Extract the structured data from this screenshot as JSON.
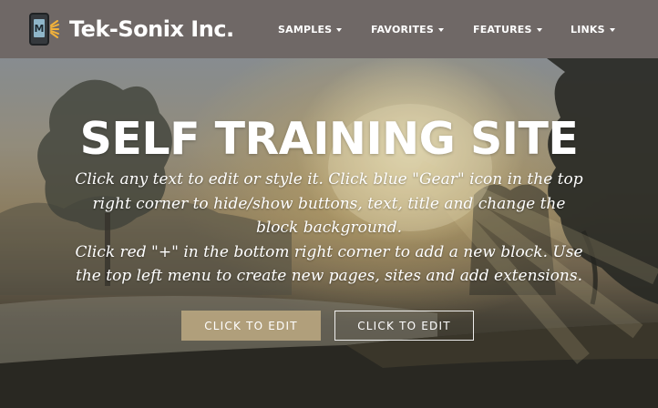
{
  "brand": {
    "logo_letter": "M",
    "name": "Tek-Sonix Inc."
  },
  "nav": {
    "items": [
      {
        "label": "SAMPLES"
      },
      {
        "label": "FAVORITES"
      },
      {
        "label": "FEATURES"
      },
      {
        "label": "LINKS"
      }
    ]
  },
  "hero": {
    "title": "SELF TRAINING SITE",
    "paragraph1": "Click any text to edit or style it. Click blue \"Gear\" icon in the top right corner to hide/show buttons, text, title and change the block background.",
    "paragraph2": "Click red \"+\" in the bottom right corner to add a new block. Use the top left menu to create new pages, sites and add extensions.",
    "button_primary": "CLICK TO EDIT",
    "button_secondary": "CLICK TO EDIT"
  },
  "icons": {
    "logo": "phone-logo-icon",
    "caret": "caret-down-icon"
  },
  "colors": {
    "navbar": "#6f6866",
    "primary_button": "#beaa82",
    "text": "#ffffff"
  }
}
